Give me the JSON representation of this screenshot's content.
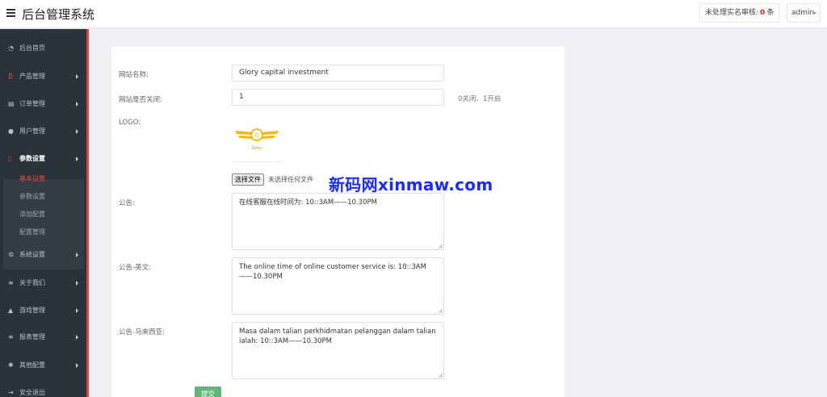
{
  "header": {
    "title": "后台管理系统",
    "pending_label": "未处理实名审核:",
    "pending_count": "0",
    "pending_unit": "条",
    "user": "admin"
  },
  "sidebar": {
    "items": [
      {
        "label": "后台首页",
        "icon": "dashboard-icon"
      },
      {
        "label": "产品管理",
        "icon": "bitcoin-icon"
      },
      {
        "label": "订单管理",
        "icon": "order-icon"
      },
      {
        "label": "用户管理",
        "icon": "user-icon"
      },
      {
        "label": "参数设置",
        "icon": "file-icon"
      },
      {
        "label": "系统设置",
        "icon": "gears-icon"
      },
      {
        "label": "关于我们",
        "icon": "list-icon"
      },
      {
        "label": "游戏管理",
        "icon": "bell-icon"
      },
      {
        "label": "报表管理",
        "icon": "list-icon"
      },
      {
        "label": "其他配置",
        "icon": "gear-icon"
      },
      {
        "label": "安全退出",
        "icon": "logout-icon"
      }
    ],
    "subitems": [
      "基本设置",
      "参数设置",
      "添加配置",
      "配置管理"
    ]
  },
  "form": {
    "site_name_label": "网站名称:",
    "site_name_value": "Glory capital investment",
    "site_closed_label": "网站是否关闭:",
    "site_closed_value": "1",
    "site_closed_hint": "0关闭、1开启",
    "logo_label": "LOGO:",
    "logo_text": "Glory",
    "logo_letter": "G",
    "file_button": "选择文件",
    "file_none": "未选择任何文件",
    "notice_label": "公告:",
    "notice_value": "在线客服在线时间为: 10::3AM——10.30PM",
    "notice_en_label": "公告-英文:",
    "notice_en_value": "The online time of online customer service is: 10::3AM——10.30PM",
    "notice_my_label": "公告-马来西亚:",
    "notice_my_value": "Masa dalam talian perkhidmatan pelanggan dalam talian ialah: 10::3AM——10.30PM",
    "submit": "提交"
  },
  "watermark": "新码网xinmaw.com",
  "colors": {
    "accent": "#d9443b",
    "sidebar": "#2b323c",
    "submit": "#5fb878",
    "logo": "#f5b800",
    "watermark": "#1a2bff"
  }
}
